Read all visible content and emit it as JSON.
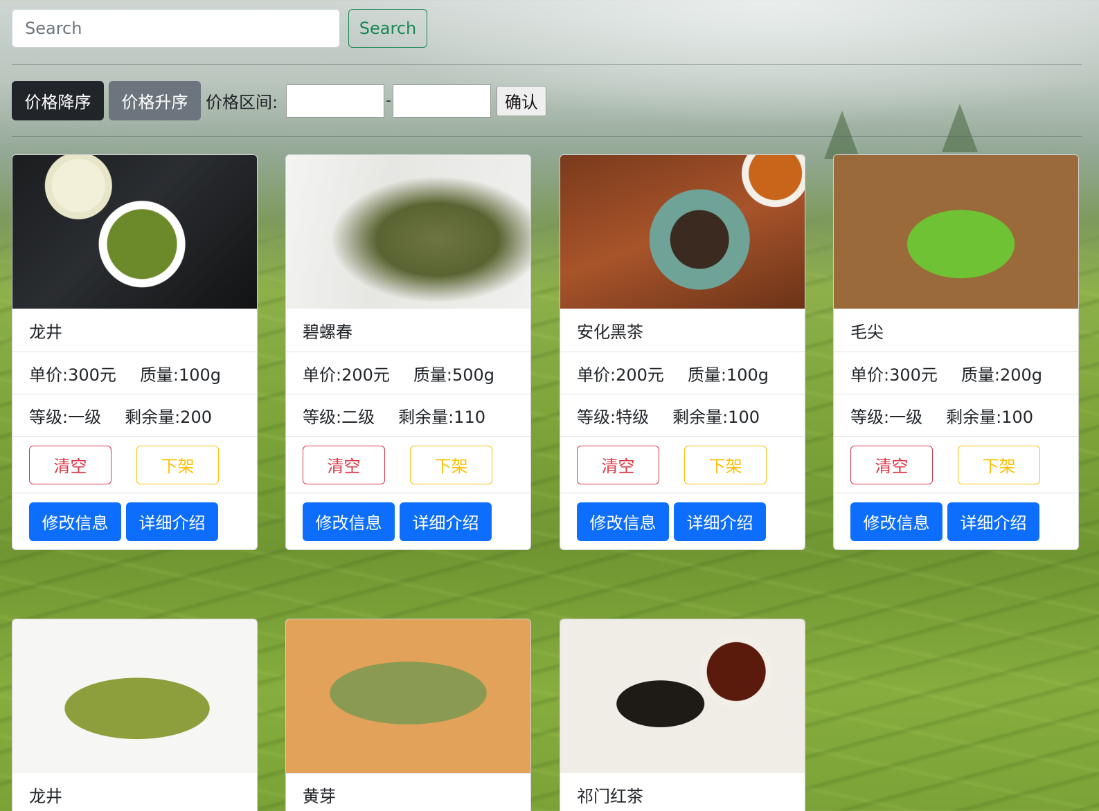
{
  "search": {
    "placeholder": "Search",
    "button_label": "Search"
  },
  "filters": {
    "sort_desc_label": "价格降序",
    "sort_asc_label": "价格升序",
    "range_label": "价格区间:",
    "range_separator": "-",
    "confirm_label": "确认"
  },
  "labels": {
    "price": "单价:",
    "weight": "质量:",
    "grade": "等级:",
    "stock": "剩余量:",
    "clear": "清空",
    "off_shelf": "下架",
    "edit": "修改信息",
    "detail": "详细介绍"
  },
  "products": [
    {
      "name": "龙井",
      "price": "单价:300元",
      "weight": "质量:100g",
      "grade": "等级:一级",
      "stock": "剩余量:200",
      "image": "longjing"
    },
    {
      "name": "碧螺春",
      "price": "单价:200元",
      "weight": "质量:500g",
      "grade": "等级:二级",
      "stock": "剩余量:110",
      "image": "biluochun"
    },
    {
      "name": "安化黑茶",
      "price": "单价:200元",
      "weight": "质量:100g",
      "grade": "等级:特级",
      "stock": "剩余量:100",
      "image": "heicha"
    },
    {
      "name": "毛尖",
      "price": "单价:300元",
      "weight": "质量:200g",
      "grade": "等级:一级",
      "stock": "剩余量:100",
      "image": "maojian"
    },
    {
      "name": "龙井",
      "image": "longjing2"
    },
    {
      "name": "黄芽",
      "image": "huangya"
    },
    {
      "name": "祁门红茶",
      "image": "qimen"
    }
  ],
  "colors": {
    "primary": "#0d6efd",
    "danger": "#dc3545",
    "warning": "#ffc107",
    "success": "#198754",
    "dark": "#212529",
    "secondary": "#6c757d"
  }
}
